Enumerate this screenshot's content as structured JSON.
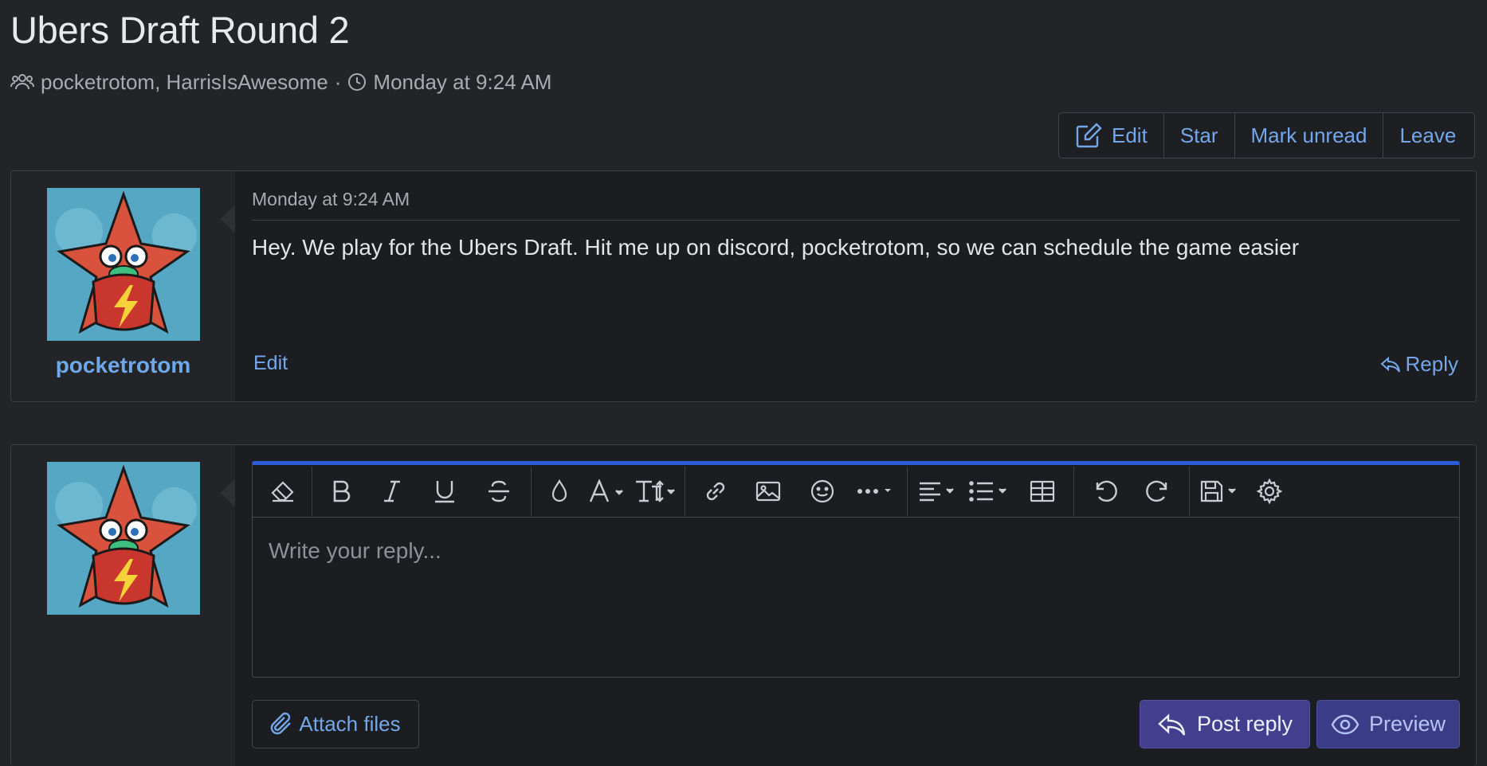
{
  "thread": {
    "title": "Ubers Draft Round 2",
    "participants": "pocketrotom, HarrisIsAwesome",
    "separator": "·",
    "started": "Monday at 9:24 AM"
  },
  "actions": {
    "edit": "Edit",
    "star": "Star",
    "mark_unread": "Mark unread",
    "leave": "Leave"
  },
  "message": {
    "author": "pocketrotom",
    "date": "Monday at 9:24 AM",
    "body": "Hey. We play for the Ubers Draft. Hit me up on discord, pocketrotom, so we can schedule the game easier",
    "edit_label": "Edit",
    "reply_label": "Reply"
  },
  "reply_form": {
    "placeholder": "Write your reply...",
    "attach_label": "Attach files",
    "post_label": "Post reply",
    "preview_label": "Preview",
    "toolbar_icons": [
      "eraser-icon",
      "bold-icon",
      "italic-icon",
      "underline-icon",
      "strikethrough-icon",
      "color-drop-icon",
      "font-family-icon",
      "font-size-icon",
      "link-icon",
      "image-icon",
      "smiley-icon",
      "more-icon",
      "align-icon",
      "list-icon",
      "table-icon",
      "undo-icon",
      "redo-icon",
      "drafts-icon",
      "settings-icon"
    ]
  },
  "colors": {
    "background": "#232427",
    "panel": "#1c1d20",
    "link": "#74a7ea",
    "accent_bar": "#2b5bd6",
    "primary_button": "#443e8e"
  }
}
